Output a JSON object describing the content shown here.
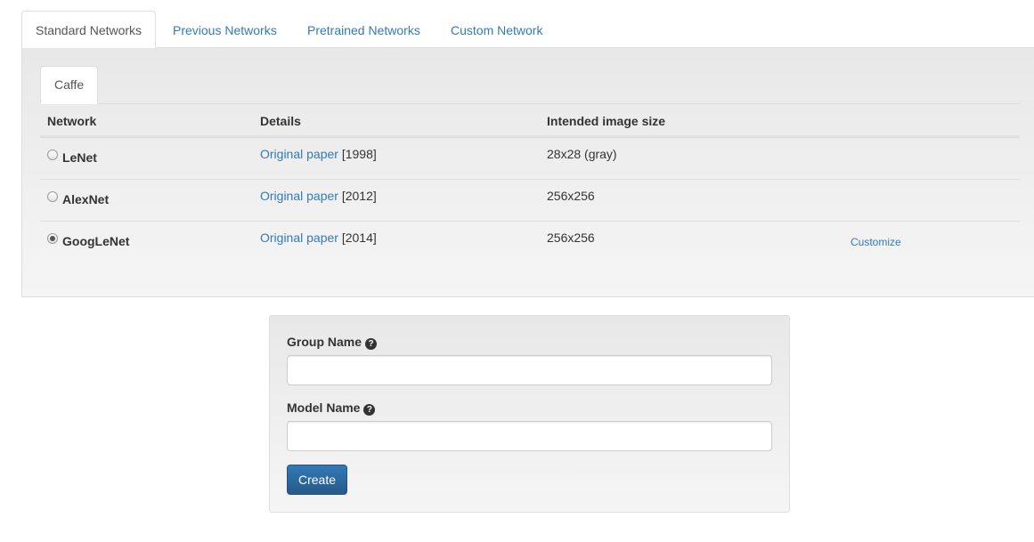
{
  "top_tabs": [
    {
      "label": "Standard Networks",
      "active": true
    },
    {
      "label": "Previous Networks",
      "active": false
    },
    {
      "label": "Pretrained Networks",
      "active": false
    },
    {
      "label": "Custom Network",
      "active": false
    }
  ],
  "framework_tab": {
    "label": "Caffe"
  },
  "table": {
    "headers": {
      "network": "Network",
      "details": "Details",
      "size": "Intended image size"
    },
    "rows": [
      {
        "name": "LeNet",
        "link": "Original paper",
        "year": "[1998]",
        "size": "28x28 (gray)",
        "selected": false,
        "customize": ""
      },
      {
        "name": "AlexNet",
        "link": "Original paper",
        "year": "[2012]",
        "size": "256x256",
        "selected": false,
        "customize": ""
      },
      {
        "name": "GoogLeNet",
        "link": "Original paper",
        "year": "[2014]",
        "size": "256x256",
        "selected": true,
        "customize": "Customize"
      }
    ]
  },
  "form": {
    "group_name_label": "Group Name",
    "group_name_value": "",
    "model_name_label": "Model Name",
    "model_name_value": "",
    "help_icon_glyph": "?",
    "create_label": "Create"
  },
  "colors": {
    "link": "#337ab7",
    "button": "#337ab7"
  }
}
